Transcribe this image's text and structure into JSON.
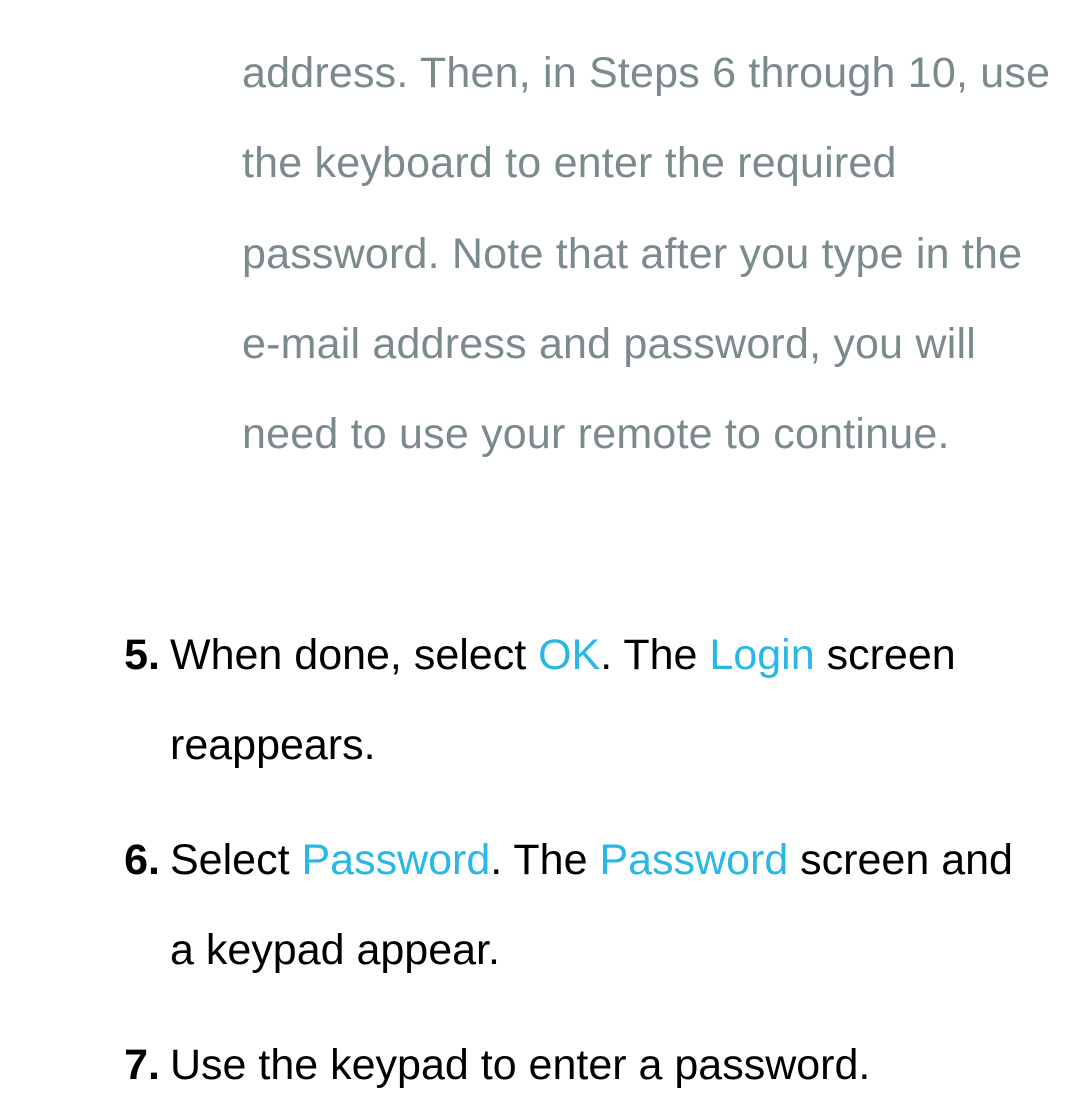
{
  "intro": "address. Then, in Steps 6 through 10, use the keyboard to enter the required password. Note that after you type in the e-mail address and password, you will need to use your remote to continue.",
  "step5": {
    "number": "5.",
    "t1": "When done, select ",
    "h1": "OK",
    "t2": ". The ",
    "h2": "Login",
    "t3": " screen reappears."
  },
  "step6": {
    "number": "6.",
    "t1": "Select ",
    "h1": "Password",
    "t2": ". The ",
    "h2": "Password",
    "t3": " screen and a keypad appear."
  },
  "step7": {
    "number": "7.",
    "t1": "Use the keypad to enter a password."
  }
}
